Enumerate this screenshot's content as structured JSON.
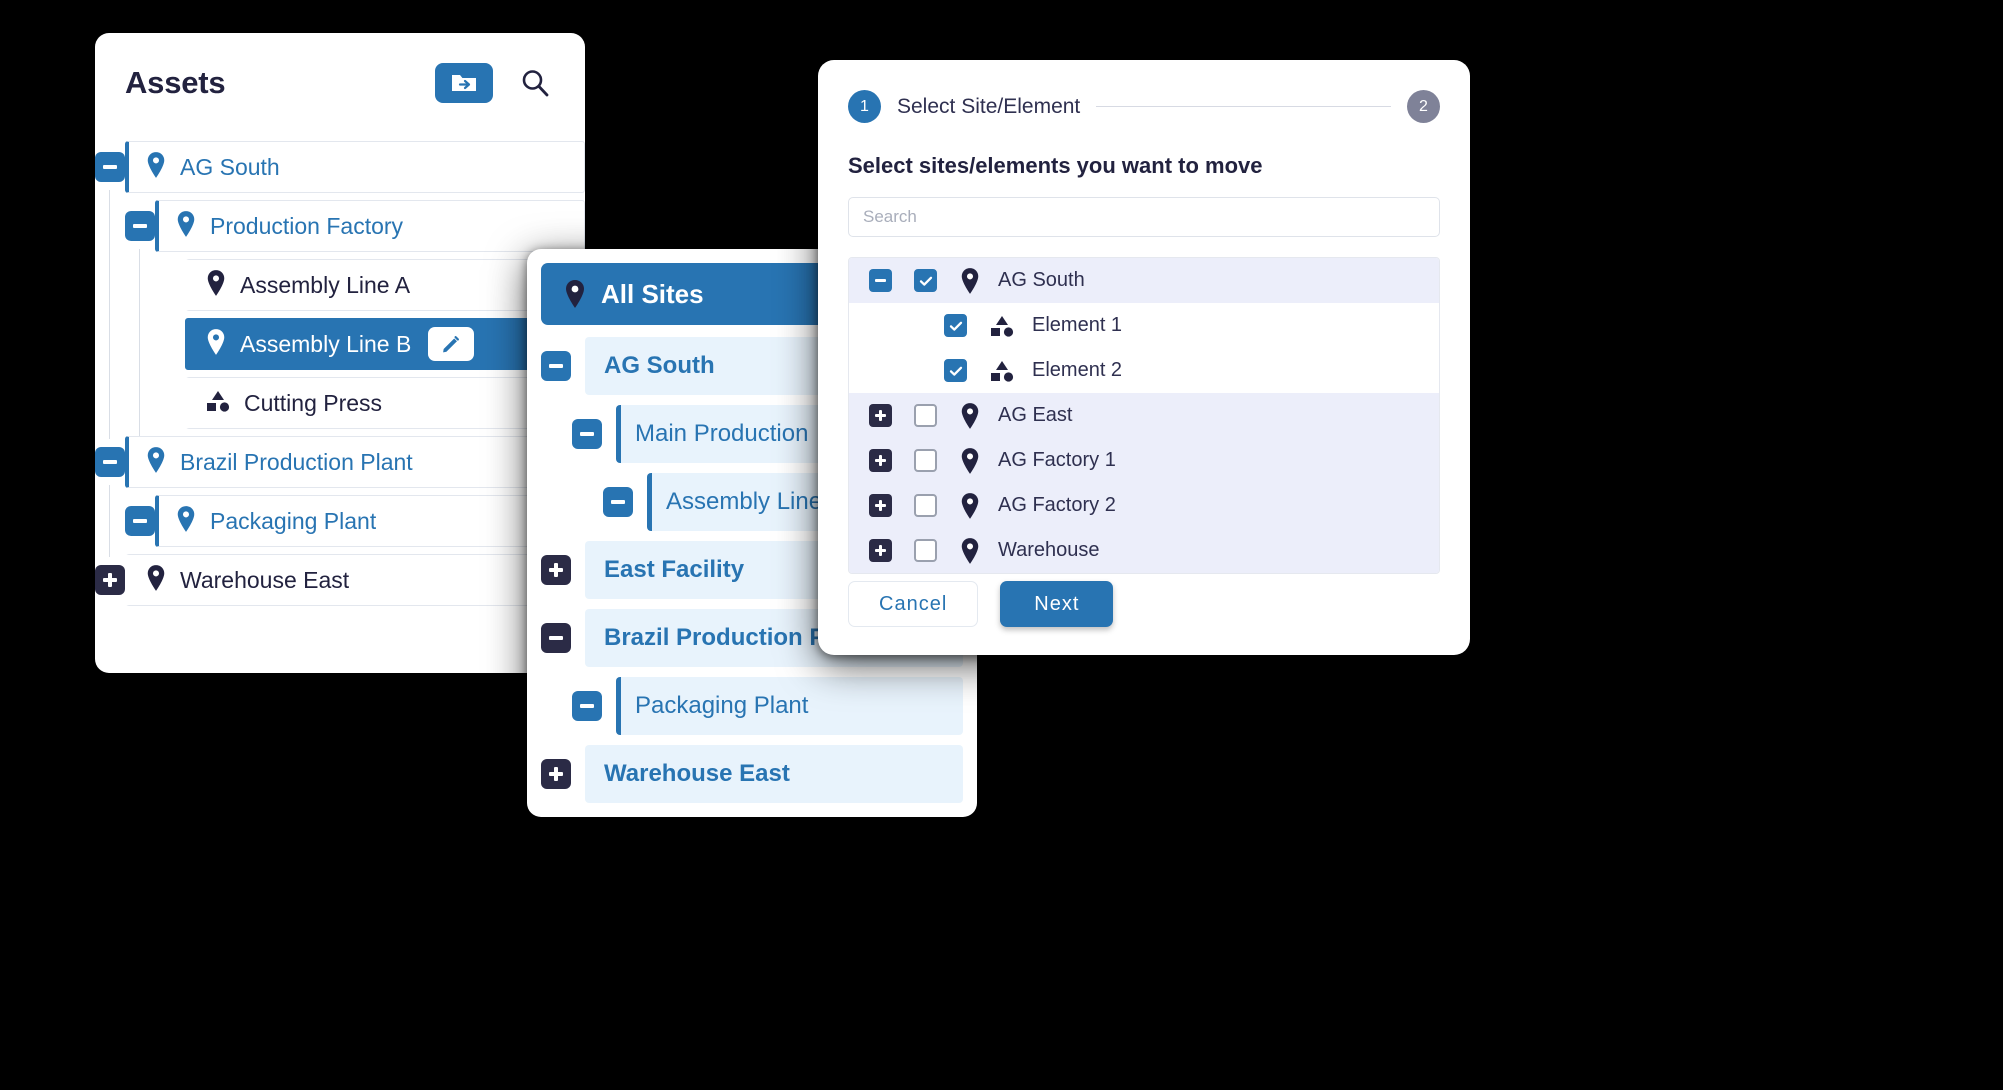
{
  "assets_panel": {
    "title": "Assets",
    "move_button_icon": "folder-move-icon",
    "search_button_icon": "search-icon",
    "tree": [
      {
        "label": "AG South",
        "icon": "location-pin-icon",
        "depth": 0,
        "expander": "minus",
        "expander_color": "blue",
        "kind": "site",
        "selected": false,
        "edit": false
      },
      {
        "label": "Production Factory",
        "icon": "location-pin-icon",
        "depth": 1,
        "expander": "minus",
        "expander_color": "blue",
        "kind": "site",
        "selected": false,
        "edit": false
      },
      {
        "label": "Assembly Line A",
        "icon": "location-pin-icon",
        "depth": 2,
        "expander": "none",
        "expander_color": "none",
        "kind": "leaf",
        "selected": false,
        "edit": false
      },
      {
        "label": "Assembly Line B",
        "icon": "location-pin-icon",
        "depth": 2,
        "expander": "none",
        "expander_color": "none",
        "kind": "leaf",
        "selected": true,
        "edit": true
      },
      {
        "label": "Cutting Press",
        "icon": "element-shapes-icon",
        "depth": 2,
        "expander": "none",
        "expander_color": "none",
        "kind": "element",
        "selected": false,
        "edit": false
      },
      {
        "label": "Brazil Production Plant",
        "icon": "location-pin-icon",
        "depth": 0,
        "expander": "minus",
        "expander_color": "blue",
        "kind": "site",
        "selected": false,
        "edit": false
      },
      {
        "label": "Packaging Plant",
        "icon": "location-pin-icon",
        "depth": 1,
        "expander": "minus",
        "expander_color": "blue",
        "kind": "site",
        "selected": false,
        "edit": false
      },
      {
        "label": "Warehouse East",
        "icon": "location-pin-icon",
        "depth": 0,
        "expander": "plus",
        "expander_color": "navy",
        "kind": "leaf",
        "selected": false,
        "edit": false
      }
    ],
    "edit_icon": "pencil-icon"
  },
  "sites_panel": {
    "header_label": "All Sites",
    "header_icon": "location-pin-icon",
    "tree": [
      {
        "label": "AG South",
        "depth": 0,
        "expander": "minus",
        "expander_color": "blue",
        "bold": true,
        "child_bar": false
      },
      {
        "label": "Main Production",
        "depth": 1,
        "expander": "minus",
        "expander_color": "blue",
        "bold": false,
        "child_bar": true
      },
      {
        "label": "Assembly Line A",
        "depth": 2,
        "expander": "minus",
        "expander_color": "blue",
        "bold": false,
        "child_bar": true
      },
      {
        "label": "East Facility",
        "depth": 0,
        "expander": "plus",
        "expander_color": "navy",
        "bold": true,
        "child_bar": false
      },
      {
        "label": "Brazil Production Plant",
        "depth": 0,
        "expander": "minus",
        "expander_color": "navy",
        "bold": true,
        "child_bar": false
      },
      {
        "label": "Packaging Plant",
        "depth": 1,
        "expander": "minus",
        "expander_color": "blue",
        "bold": false,
        "child_bar": true
      },
      {
        "label": "Warehouse East",
        "depth": 0,
        "expander": "plus",
        "expander_color": "navy",
        "bold": true,
        "child_bar": false
      }
    ]
  },
  "move_dialog": {
    "steps": [
      {
        "number": "1",
        "label": "Select Site/Element",
        "state": "active"
      },
      {
        "number": "2",
        "label": "",
        "state": "inactive"
      }
    ],
    "subtitle": "Select sites/elements you want to move",
    "search_placeholder": "Search",
    "search_value": "",
    "rows": [
      {
        "label": "AG South",
        "icon": "location-pin-icon",
        "depth": 0,
        "expander": "minus",
        "expander_color": "blue",
        "checked": true,
        "shaded": true
      },
      {
        "label": "Element 1",
        "icon": "element-shapes-icon",
        "depth": 1,
        "expander": "none",
        "expander_color": "none",
        "checked": true,
        "shaded": false
      },
      {
        "label": "Element 2",
        "icon": "element-shapes-icon",
        "depth": 1,
        "expander": "none",
        "expander_color": "none",
        "checked": true,
        "shaded": false
      },
      {
        "label": "AG East",
        "icon": "location-pin-icon",
        "depth": 0,
        "expander": "plus",
        "expander_color": "navy",
        "checked": false,
        "shaded": true
      },
      {
        "label": "AG Factory 1",
        "icon": "location-pin-icon",
        "depth": 0,
        "expander": "plus",
        "expander_color": "navy",
        "checked": false,
        "shaded": true
      },
      {
        "label": "AG Factory 2",
        "icon": "location-pin-icon",
        "depth": 0,
        "expander": "plus",
        "expander_color": "navy",
        "checked": false,
        "shaded": true
      },
      {
        "label": "Warehouse",
        "icon": "location-pin-icon",
        "depth": 0,
        "expander": "plus",
        "expander_color": "navy",
        "checked": false,
        "shaded": true
      }
    ],
    "cancel_label": "Cancel",
    "next_label": "Next"
  },
  "colors": {
    "accent_blue": "#2874b2",
    "navy": "#2b2b46",
    "row_highlight": "#e8f3fc",
    "dialog_row_shade": "#eceefa",
    "background": "#000000"
  }
}
